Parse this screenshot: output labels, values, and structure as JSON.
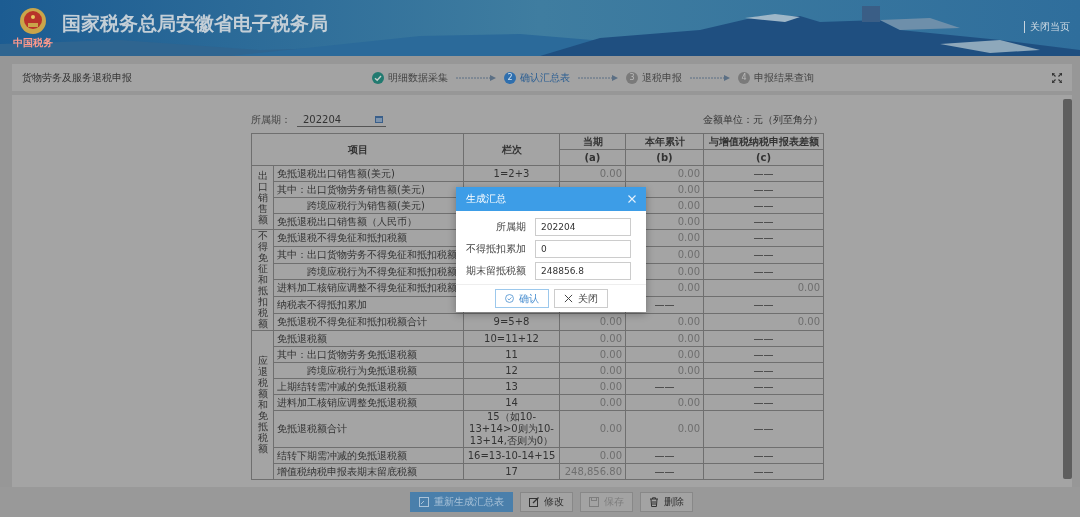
{
  "header": {
    "logo_caption": "中国税务",
    "title": "国家税务总局安徽省电子税务局",
    "close_link": "关闭当页"
  },
  "page": {
    "title": "货物劳务及服务退税申报",
    "steps": [
      {
        "label": "明细数据采集",
        "done": true,
        "selected": false
      },
      {
        "number": "2",
        "label": "确认汇总表",
        "done": false,
        "selected": true
      },
      {
        "number": "3",
        "label": "退税申报",
        "done": false,
        "selected": false
      },
      {
        "number": "4",
        "label": "申报结果查询",
        "done": false,
        "selected": false
      }
    ]
  },
  "form": {
    "period_label": "所属期：",
    "period_value": "202204",
    "unit_note": "金额单位：元（列至角分）"
  },
  "table": {
    "columns": [
      "项目",
      "栏次",
      "当期",
      "本年累计",
      "与增值税纳税申报表差额"
    ],
    "sub_columns": [
      "(a)",
      "(b)",
      "(c)"
    ],
    "groups": [
      {
        "label": "出口销售额",
        "rows": [
          {
            "item": "免抵退税出口销售额(美元)",
            "indented": false,
            "line": "1=2+3",
            "current": "0.00",
            "ytd": "0.00",
            "diff": "——"
          },
          {
            "item": "其中：出口货物劳务销售额(美元)",
            "indented": false,
            "ytd": "0.00",
            "diff": "——"
          },
          {
            "item": "跨境应税行为销售额(美元)",
            "indented": true,
            "ytd": "0.00",
            "diff": "——"
          },
          {
            "item": "免抵退税出口销售额（人民币）",
            "indented": false,
            "ytd": "0.00",
            "diff": "——"
          }
        ]
      },
      {
        "label": "不得免征和抵扣税额",
        "rows": [
          {
            "item": "免抵退税不得免征和抵扣税额",
            "indented": false,
            "ytd": "0.00",
            "diff": "——"
          },
          {
            "item": "其中：出口货物劳务不得免征和抵扣税额",
            "indented": false,
            "ytd": "0.00",
            "diff": "——"
          },
          {
            "item": "跨境应税行为不得免征和抵扣税额",
            "indented": true,
            "ytd": "0.00",
            "diff": "——"
          },
          {
            "item": "进料加工核销应调整不得免征和抵扣税额",
            "indented": false,
            "ytd": "0.00",
            "diff": "0.00"
          },
          {
            "item": "纳税表不得抵扣累加",
            "indented": false,
            "ytd": "——",
            "diff": "——"
          },
          {
            "item": "免抵退税不得免征和抵扣税额合计",
            "indented": false,
            "line": "9=5+8",
            "current": "0.00",
            "ytd": "0.00",
            "diff": "0.00"
          }
        ]
      },
      {
        "label": "应退税额和免抵税额",
        "rows": [
          {
            "item": "免抵退税额",
            "indented": false,
            "line": "10=11+12",
            "current": "0.00",
            "ytd": "0.00",
            "diff": "——"
          },
          {
            "item": "其中：出口货物劳务免抵退税额",
            "indented": false,
            "line": "11",
            "current": "0.00",
            "ytd": "0.00",
            "diff": "——"
          },
          {
            "item": "跨境应税行为免抵退税额",
            "indented": true,
            "line": "12",
            "current": "0.00",
            "ytd": "0.00",
            "diff": "——"
          },
          {
            "item": "上期结转需冲减的免抵退税额",
            "indented": false,
            "line": "13",
            "current": "0.00",
            "ytd": "——",
            "diff": "——"
          },
          {
            "item": "进料加工核销应调整免抵退税额",
            "indented": false,
            "line": "14",
            "current": "0.00",
            "ytd": "0.00",
            "diff": "——"
          },
          {
            "item": "免抵退税额合计",
            "indented": false,
            "line": "15（如10-13+14>0则为10-13+14,否则为0）",
            "current": "0.00",
            "ytd": "0.00",
            "diff": "——"
          },
          {
            "item": "结转下期需冲减的免抵退税额",
            "indented": false,
            "line": "16=13-10-14+15",
            "current": "0.00",
            "ytd": "——",
            "diff": "——"
          },
          {
            "item": "增值税纳税申报表期末留底税额",
            "indented": false,
            "line": "17",
            "current": "248,856.80",
            "ytd": "——",
            "diff": "——"
          }
        ]
      }
    ]
  },
  "dialog": {
    "title": "生成汇总",
    "fields": [
      {
        "label": "所属期",
        "value": "202204"
      },
      {
        "label": "不得抵扣累加",
        "value": "0"
      },
      {
        "label": "期末留抵税额",
        "value": "248856.8"
      }
    ],
    "buttons": [
      {
        "label": "确认",
        "kind": "primary"
      },
      {
        "label": "关闭",
        "kind": "default"
      }
    ]
  },
  "actions": [
    {
      "label": "重新生成汇总表",
      "kind": "primary",
      "disabled": false
    },
    {
      "label": "修改",
      "kind": "default",
      "disabled": false
    },
    {
      "label": "保存",
      "kind": "default",
      "disabled": true
    },
    {
      "label": "删除",
      "kind": "default",
      "disabled": false
    }
  ]
}
